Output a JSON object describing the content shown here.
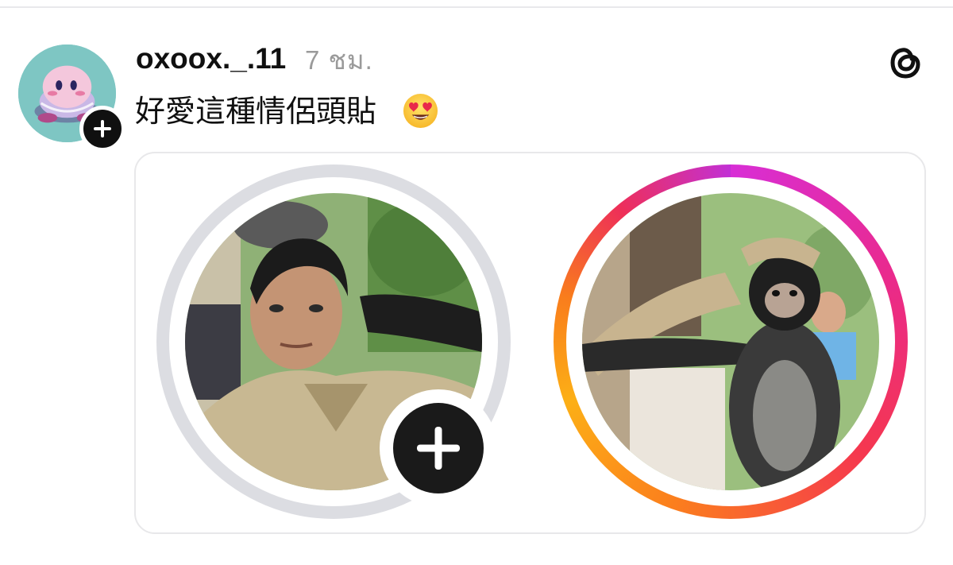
{
  "post": {
    "username": "oxoox._.11",
    "timestamp": "7 ชม.",
    "text": "好愛這種情侶頭貼",
    "emoji": "smiling-face-with-heart-eyes"
  },
  "icons": {
    "threads": "threads-logo-icon",
    "follow": "plus-icon"
  },
  "colors": {
    "text_primary": "#101010",
    "text_secondary": "#9a9a9a",
    "card_border": "#e8e8ea",
    "ring_grey": "#dcdde2",
    "ring_gradient": [
      "#d82ed6",
      "#ea2a8a",
      "#f5374f",
      "#fb7f1d",
      "#fcaf16"
    ]
  }
}
